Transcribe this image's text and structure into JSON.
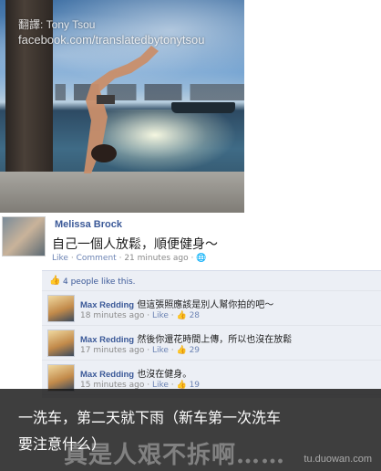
{
  "photo": {
    "watermark_line1": "翻譯: Tony Tsou",
    "watermark_line2": "facebook.com/translatedbytonytsou"
  },
  "post": {
    "author": "Melissa Brock",
    "text": "自己一個人放鬆，順便健身～",
    "like": "Like",
    "comment": "Comment",
    "time": "21 minutes ago",
    "separator": "·",
    "privacy_icon": "globe-icon"
  },
  "comments_box": {
    "likes_text": "4 people like this.",
    "items": [
      {
        "author": "Max Redding",
        "text": "但這張照應該是別人幫你拍的吧～",
        "time": "18 minutes ago",
        "like": "Like",
        "likes": "28"
      },
      {
        "author": "Max Redding",
        "text": "然後你還花時間上傳，所以也沒在放鬆",
        "time": "17 minutes ago",
        "like": "Like",
        "likes": "29"
      },
      {
        "author": "Max Redding",
        "text": "也沒在健身。",
        "time": "15 minutes ago",
        "like": "Like",
        "likes": "19"
      }
    ]
  },
  "caption": {
    "line1": "一洗车，第二天就下雨（新车第一次洗车",
    "line2": "要注意什么）",
    "overlay": "真是人艰不拆啊……",
    "site": "tu.duowan.com"
  },
  "colors": {
    "link": "#3b5998",
    "meta": "#8a8a8a",
    "comment_bg": "#eceff5"
  }
}
